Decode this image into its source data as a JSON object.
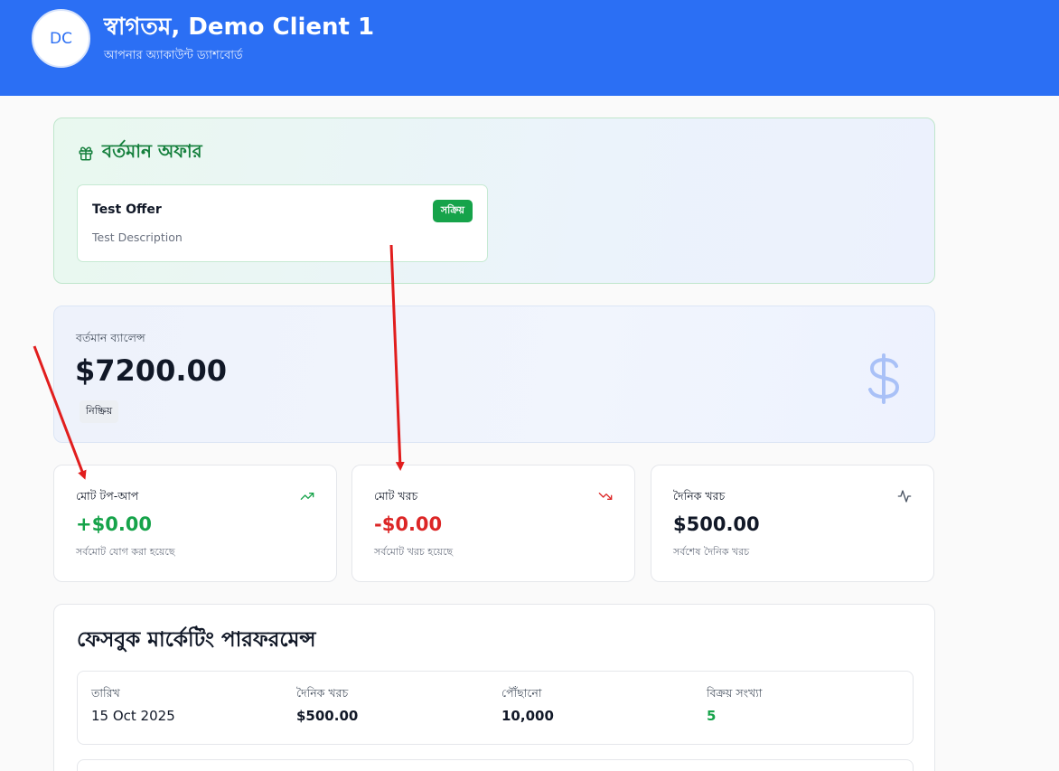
{
  "header": {
    "avatar_initials": "DC",
    "welcome": "স্বাগতম, Demo Client 1",
    "subtitle": "আপনার অ্যাকাউন্ট ড্যাশবোর্ড"
  },
  "offers": {
    "title": "বর্তমান অফার",
    "items": [
      {
        "name": "Test Offer",
        "description": "Test Description",
        "status": "সক্রিয়"
      }
    ]
  },
  "balance": {
    "label": "বর্তমান ব্যালেন্স",
    "amount": "$7200.00",
    "status": "নিষ্ক্রিয়"
  },
  "stats": [
    {
      "label": "মোট টপ-আপ",
      "value": "+$0.00",
      "sub": "সর্বমোট যোগ করা হয়েছে",
      "icon": "trending-up-icon",
      "color": "#16a34a"
    },
    {
      "label": "মোট খরচ",
      "value": "-$0.00",
      "sub": "সর্বমোট খরচ হয়েছে",
      "icon": "trending-down-icon",
      "color": "#dc2626"
    },
    {
      "label": "দৈনিক খরচ",
      "value": "$500.00",
      "sub": "সর্বশেষ দৈনিক খরচ",
      "icon": "activity-icon",
      "color": "#111827"
    }
  ],
  "performance": {
    "title": "ফেসবুক মার্কেটিং পারফরমেন্স",
    "rows": [
      {
        "date_label": "তারিখ",
        "date": "15 Oct 2025",
        "spend_label": "দৈনিক খরচ",
        "spend": "$500.00",
        "reach_label": "পৌঁছানো",
        "reach": "10,000",
        "sales_label": "বিক্রয় সংখ্যা",
        "sales": "5"
      }
    ]
  },
  "colors": {
    "header_bg": "#2b6ff4",
    "offer_accent": "#15803d",
    "positive": "#16a34a",
    "negative": "#dc2626",
    "annotation_arrow": "#e11d1d"
  }
}
